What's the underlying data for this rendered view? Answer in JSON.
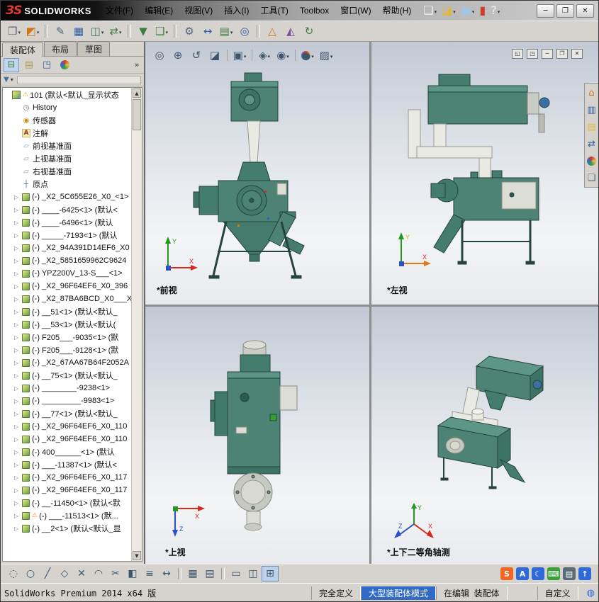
{
  "colors": {
    "logo_red": "#e03a2f",
    "toolbar_bg": "#d6d3ce",
    "accent_blue": "#316ac5",
    "machine_teal": "#4c8374",
    "viewport_gradient_top": "#c3c9d4",
    "viewport_gradient_bottom": "#e8eaee",
    "warning_yellow": "#e0a010"
  },
  "axes": {
    "x": "X",
    "y": "Y",
    "z": "Z"
  },
  "titlebar": {
    "logo_mark": "ЗS",
    "logo_text": "SOLIDWORKS",
    "menus": [
      {
        "label": "文件(F)"
      },
      {
        "label": "编辑(E)"
      },
      {
        "label": "视图(V)"
      },
      {
        "label": "插入(I)"
      },
      {
        "label": "工具(T)"
      },
      {
        "label": "Toolbox"
      },
      {
        "label": "窗口(W)"
      },
      {
        "label": "帮助(H)"
      }
    ],
    "quick_icons": [
      {
        "cls": "qbtn",
        "n": "new-document-icon",
        "g": "❏",
        "c": "white",
        "dd": "y"
      },
      {
        "cls": "qbtn",
        "n": "open-document-icon",
        "g": "◪",
        "c": "yellow",
        "dd": "y"
      },
      {
        "cls": "qbtn",
        "n": "save-icon",
        "g": "▣",
        "c": "lblue",
        "dd": "y"
      },
      {
        "cls": "qbtn",
        "n": "status-indicator-icon",
        "g": "▮",
        "c": "red",
        "dd": ""
      },
      {
        "cls": "qbtn",
        "n": "help-icon",
        "g": "?",
        "c": "white",
        "dd": "y"
      }
    ],
    "controls": [
      {
        "glyph": "─",
        "name": "minimize"
      },
      {
        "glyph": "❐",
        "name": "maximize"
      },
      {
        "glyph": "✕",
        "name": "close"
      }
    ]
  },
  "toolbar": {
    "buttons": [
      {
        "cls": "tbtn",
        "n": "screen-capture-button",
        "g": "❒",
        "c": "slate",
        "dd": "y"
      },
      {
        "cls": "tbtn",
        "n": "appearances-button",
        "g": "◩",
        "c": "orange",
        "dd": "y"
      },
      {
        "cls": "tsep",
        "n": "separator"
      },
      {
        "cls": "tbtn",
        "n": "attachments-button",
        "g": "✎",
        "c": "slate",
        "dd": ""
      },
      {
        "cls": "tbtn",
        "n": "design-table-button",
        "g": "▦",
        "c": "blue",
        "dd": ""
      },
      {
        "cls": "tbtn",
        "n": "display-states-button",
        "g": "◫",
        "c": "teal",
        "dd": "y"
      },
      {
        "cls": "tbtn",
        "n": "import-export-button",
        "g": "⇄",
        "c": "green",
        "dd": "y"
      },
      {
        "cls": "tsep",
        "n": "separator"
      },
      {
        "cls": "tbtn",
        "n": "selection-filter-button",
        "g": "▼",
        "c": "green",
        "dd": ""
      },
      {
        "cls": "tbtn",
        "n": "insert-component-button",
        "g": "❑",
        "c": "green",
        "dd": "y"
      },
      {
        "cls": "tsep",
        "n": "separator"
      },
      {
        "cls": "tbtn",
        "n": "smart-fasteners-button",
        "g": "⚙",
        "c": "slate",
        "dd": ""
      },
      {
        "cls": "tbtn",
        "n": "move-component-button",
        "g": "↔",
        "c": "blue",
        "dd": ""
      },
      {
        "cls": "tbtn",
        "n": "component-pattern-button",
        "g": "▤",
        "c": "green",
        "dd": "y"
      },
      {
        "cls": "tbtn",
        "n": "mate-button",
        "g": "◎",
        "c": "blue",
        "dd": ""
      },
      {
        "cls": "tsep",
        "n": "separator"
      },
      {
        "cls": "tbtn",
        "n": "exploded-view-button",
        "g": "△",
        "c": "orange",
        "dd": ""
      },
      {
        "cls": "tbtn",
        "n": "interference-detection-button",
        "g": "◭",
        "c": "purple",
        "dd": ""
      },
      {
        "cls": "tbtn",
        "n": "rebuild-button",
        "g": "↻",
        "c": "green",
        "dd": ""
      }
    ]
  },
  "left_panel": {
    "tabs": [
      {
        "cls": "tab active",
        "label": "装配体"
      },
      {
        "cls": "tab",
        "label": "布局"
      },
      {
        "cls": "tab",
        "label": "草图"
      }
    ],
    "panel_icons": [
      {
        "cls": "pbtn active",
        "n": "featuremanager-tree-icon",
        "g": "⊟",
        "c": "green"
      },
      {
        "cls": "pbtn",
        "n": "propertymanager-icon",
        "g": "▤",
        "c": "tan"
      },
      {
        "cls": "pbtn",
        "n": "configurationmanager-icon",
        "g": "◳",
        "c": "blue"
      },
      {
        "cls": "pbtn ball",
        "n": "displaymanager-icon",
        "g": "●"
      }
    ],
    "chevron": "»",
    "filter_glyph": "▼",
    "filter_dd": "▾",
    "scroll_up": "▲",
    "scroll_down": "▼",
    "tree": {
      "items": [
        {
          "icon": "root",
          "label": "101 (默认<默认_显示状态"
        },
        {
          "icon": "history",
          "label": "History"
        },
        {
          "icon": "sensors",
          "label": "传感器"
        },
        {
          "icon": "annotations",
          "label": "注解"
        },
        {
          "icon": "plane",
          "label": "前视基准面"
        },
        {
          "icon": "plane",
          "label": "上视基准面"
        },
        {
          "icon": "plane",
          "label": "右视基准面"
        },
        {
          "icon": "origin",
          "label": "原点"
        },
        {
          "icon": "comp",
          "label": "(-) _X2_5C655E26_X0_<1>"
        },
        {
          "icon": "comp",
          "label": "(-) ____-6425<1> (默认<"
        },
        {
          "icon": "comp",
          "label": "(-) ____-6496<1> (默认"
        },
        {
          "icon": "comp",
          "label": "(-) _____-7193<1> (默认"
        },
        {
          "icon": "comp",
          "label": "(-) _X2_94A391D14EF6_X0"
        },
        {
          "icon": "comp",
          "label": "(-) _X2_5851659962C9624"
        },
        {
          "icon": "comp",
          "label": "(-) YPZ200V_13-S___<1>"
        },
        {
          "icon": "comp",
          "label": "(-) _X2_96F64EF6_X0_396"
        },
        {
          "icon": "comp",
          "label": "(-) _X2_87BA6BCD_X0___X"
        },
        {
          "icon": "comp",
          "label": "(-) __51<1> (默认<默认_"
        },
        {
          "icon": "comp",
          "label": "(-) __53<1> (默认<默认("
        },
        {
          "icon": "comp",
          "label": "(-) F205___-9035<1> (默"
        },
        {
          "icon": "comp",
          "label": "(-) F205___-9128<1> (默"
        },
        {
          "icon": "comp",
          "label": "(-) _X2_67AA67B64F2052A"
        },
        {
          "icon": "comp",
          "label": "(-) __75<1> (默认<默认_"
        },
        {
          "icon": "comp",
          "label": "(-) ________-9238<1>"
        },
        {
          "icon": "comp",
          "label": "(-) _________-9983<1>"
        },
        {
          "icon": "comp",
          "label": "(-) __77<1> (默认<默认_"
        },
        {
          "icon": "comp",
          "label": "(-) _X2_96F64EF6_X0_110"
        },
        {
          "icon": "comp",
          "label": "(-) _X2_96F64EF6_X0_110"
        },
        {
          "icon": "comp",
          "label": "(-) 400______<1> (默认"
        },
        {
          "icon": "comp",
          "label": "(-) ___-11387<1> (默认<"
        },
        {
          "icon": "comp",
          "label": "(-) _X2_96F64EF6_X0_117"
        },
        {
          "icon": "comp",
          "label": "(-) _X2_96F64EF6_X0_117"
        },
        {
          "icon": "comp",
          "label": "(-) __-11450<1> (默认<默"
        },
        {
          "icon": "compwarn",
          "label": "(-) ___-11513<1> (默..."
        },
        {
          "icon": "comp",
          "label": "(-) __2<1> (默认<默认_显"
        }
      ]
    }
  },
  "viewport": {
    "views": [
      {
        "label": "*前视"
      },
      {
        "label": "*左视"
      },
      {
        "label": "*上视"
      },
      {
        "label": "*上下二等角轴测"
      }
    ],
    "headsup": [
      {
        "cls": "hbtn",
        "n": "zoom-fit-button",
        "g": "◎",
        "dd": ""
      },
      {
        "cls": "hbtn",
        "n": "zoom-area-button",
        "g": "⊕",
        "dd": ""
      },
      {
        "cls": "hbtn",
        "n": "previous-view-button",
        "g": "↺",
        "dd": ""
      },
      {
        "cls": "hbtn",
        "n": "section-view-button",
        "g": "◪",
        "dd": ""
      },
      {
        "cls": "hsep",
        "n": "separator"
      },
      {
        "cls": "hbtn",
        "n": "view-orientation-button",
        "g": "▣",
        "dd": "y"
      },
      {
        "cls": "hsep",
        "n": "separator"
      },
      {
        "cls": "hbtn",
        "n": "display-style-button",
        "g": "◈",
        "dd": "y"
      },
      {
        "cls": "hbtn",
        "n": "hide-show-items-button",
        "g": "◉",
        "dd": "y"
      },
      {
        "cls": "hsep",
        "n": "separator"
      },
      {
        "cls": "hbtn ball",
        "n": "edit-appearance-button",
        "g": "●",
        "dd": "y"
      },
      {
        "cls": "hbtn",
        "n": "apply-scene-button",
        "g": "▨",
        "dd": "y"
      }
    ],
    "window_buttons": [
      {
        "cls": "wbtn",
        "n": "tile-horizontal-button",
        "g": "◱"
      },
      {
        "cls": "wbtn",
        "n": "tile-vertical-button",
        "g": "◳"
      },
      {
        "cls": "wbtn",
        "n": "minimize-child-button",
        "g": "─"
      },
      {
        "cls": "wbtn",
        "n": "restore-child-button",
        "g": "❐"
      },
      {
        "cls": "wbtn",
        "n": "close-child-button",
        "g": "✕"
      }
    ],
    "task_pane": [
      {
        "cls": "pane-btn",
        "n": "home-icon",
        "g": "⌂",
        "c": "orange"
      },
      {
        "cls": "pane-btn",
        "n": "design-library-icon",
        "g": "▥",
        "c": "blue"
      },
      {
        "cls": "pane-btn",
        "n": "file-explorer-icon",
        "g": "▤",
        "c": "yellow"
      },
      {
        "cls": "pane-btn",
        "n": "toolbox-icon",
        "g": "⇄",
        "c": "blue"
      },
      {
        "cls": "pane-btn ball",
        "n": "appearances-scenes-icon",
        "g": "●"
      },
      {
        "cls": "pane-btn",
        "n": "custom-properties-icon",
        "g": "❏",
        "c": "slate"
      }
    ]
  },
  "bottom": {
    "buttons": [
      {
        "cls": "bbtn",
        "n": "select-tool-button",
        "g": "◌"
      },
      {
        "cls": "bbtn",
        "n": "circle-tool-button",
        "g": "○"
      },
      {
        "cls": "bbtn",
        "n": "line-tool-button",
        "g": "╱"
      },
      {
        "cls": "bbtn",
        "n": "rectangle-tool-button",
        "g": "◇"
      },
      {
        "cls": "bbtn",
        "n": "delete-tool-button",
        "g": "✕"
      },
      {
        "cls": "bbtn",
        "n": "arc-tool-button",
        "g": "◠"
      },
      {
        "cls": "bbtn",
        "n": "trim-tool-button",
        "g": "✂"
      },
      {
        "cls": "bbtn",
        "n": "mirror-tool-button",
        "g": "◧"
      },
      {
        "cls": "bbtn",
        "n": "offset-tool-button",
        "g": "≡"
      },
      {
        "cls": "bbtn",
        "n": "dimension-tool-button",
        "g": "↔"
      },
      {
        "cls": "bsep",
        "n": "separator"
      },
      {
        "cls": "bbtn",
        "n": "grid-button",
        "g": "▦"
      },
      {
        "cls": "bbtn",
        "n": "snap-button",
        "g": "▤"
      },
      {
        "cls": "bsep",
        "n": "separator"
      },
      {
        "cls": "bbtn",
        "n": "single-view-button",
        "g": "▭"
      },
      {
        "cls": "bbtn",
        "n": "two-view-button",
        "g": "◫"
      },
      {
        "cls": "bbtn active",
        "n": "four-view-button",
        "g": "⊞"
      }
    ],
    "tray": [
      {
        "n": "sogou-input-icon",
        "g": "S",
        "c": "tray-orange"
      },
      {
        "n": "language-icon",
        "g": "A",
        "c": "tray-blue"
      },
      {
        "n": "night-mode-icon",
        "g": "☾",
        "c": "tray-blue"
      },
      {
        "n": "keyboard-icon",
        "g": "⌨",
        "c": "tray-green"
      },
      {
        "n": "ime-toolbar-icon",
        "g": "▤",
        "c": "tray-slate"
      },
      {
        "n": "tray-expand-icon",
        "g": "↑",
        "c": "tray-blue"
      }
    ]
  },
  "statusbar": {
    "app": "SolidWorks Premium 2014 x64 版",
    "segments": [
      {
        "cls": "seg",
        "label": "完全定义"
      },
      {
        "cls": "seg highlight",
        "label": "大型装配体模式"
      },
      {
        "cls": "seg",
        "label": "在编辑  装配体"
      },
      {
        "cls": "seg custom",
        "label": "自定义"
      }
    ],
    "globe_glyph": "◍"
  }
}
